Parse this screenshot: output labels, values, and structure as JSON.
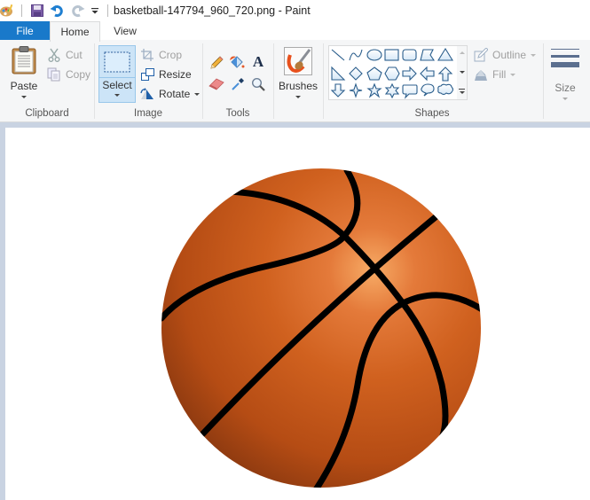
{
  "window": {
    "title": "basketball-147794_960_720.png - Paint"
  },
  "quick_access": {
    "items": [
      {
        "name": "paint-app-icon"
      },
      {
        "name": "save-icon"
      },
      {
        "name": "undo-icon"
      },
      {
        "name": "redo-icon"
      },
      {
        "name": "customize-quick-access-icon"
      }
    ]
  },
  "tabs": {
    "file": "File",
    "home": "Home",
    "view": "View",
    "active": "Home"
  },
  "ribbon": {
    "clipboard": {
      "label": "Clipboard",
      "paste": "Paste",
      "cut": "Cut",
      "copy": "Copy"
    },
    "image": {
      "label": "Image",
      "select": "Select",
      "crop": "Crop",
      "resize": "Resize",
      "rotate": "Rotate"
    },
    "tools": {
      "label": "Tools",
      "items": [
        "pencil",
        "fill-with-color",
        "text",
        "eraser",
        "color-picker",
        "magnifier"
      ]
    },
    "brushes": {
      "label": "Brushes"
    },
    "shapes": {
      "label": "Shapes",
      "items": [
        "line",
        "curve",
        "oval",
        "rectangle",
        "rounded-rectangle",
        "polygon",
        "triangle",
        "right-triangle",
        "diamond",
        "pentagon",
        "hexagon",
        "right-arrow",
        "left-arrow",
        "up-arrow",
        "down-arrow",
        "four-point-star",
        "five-point-star",
        "six-point-star",
        "rounded-rectangular-callout",
        "oval-callout",
        "cloud-callout"
      ],
      "outline": "Outline",
      "fill": "Fill"
    },
    "size": {
      "label": "Size"
    }
  },
  "canvas": {
    "image_subject": "basketball",
    "colors": {
      "ball_base": "#c8561c",
      "ball_highlight": "#f5a05a",
      "ball_shadow": "#8e3a10",
      "seams": "#000000",
      "workspace_bg": "#c9d3e2",
      "file_tab": "#1979ca",
      "select_active": "#cce4f7"
    }
  }
}
